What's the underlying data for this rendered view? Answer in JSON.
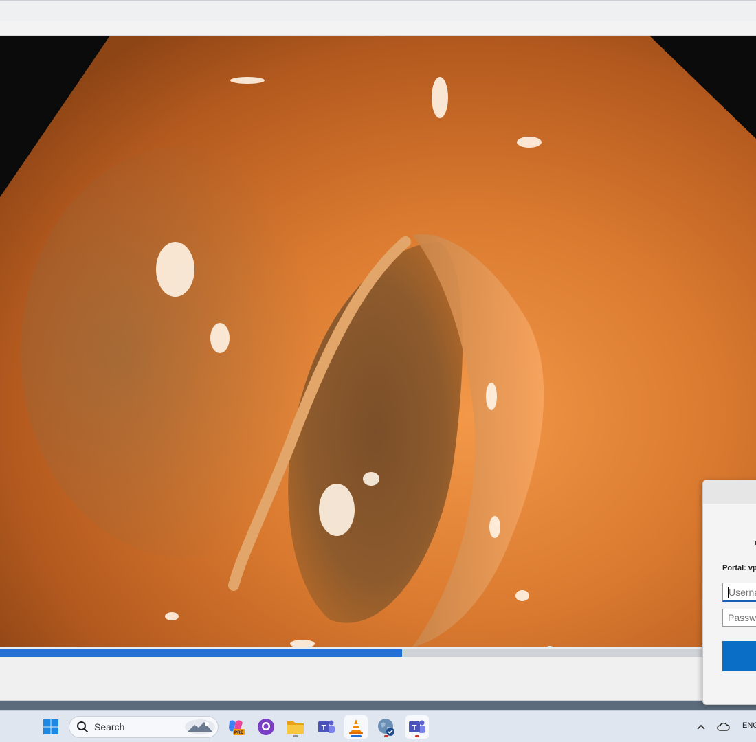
{
  "app": {
    "progress_fraction": 0.532
  },
  "vpn_dialog": {
    "portal_label": "Portal: vp",
    "username_placeholder": "Userna",
    "password_placeholder": "Passwo"
  },
  "taskbar": {
    "search_label": "Search",
    "items": [
      {
        "icon": "windows-start-icon"
      },
      {
        "icon": "copilot-pre-icon"
      },
      {
        "icon": "github-desktop-icon"
      },
      {
        "icon": "file-explorer-icon"
      },
      {
        "icon": "teams-classic-icon"
      },
      {
        "icon": "vlc-icon"
      },
      {
        "icon": "vpn-globe-icon"
      },
      {
        "icon": "teams-icon"
      }
    ],
    "tray": {
      "language": "ENG"
    }
  },
  "colors": {
    "accent": "#2470d6",
    "vpn_button": "#0a6ec7",
    "video_tissue": "#d3762f"
  }
}
